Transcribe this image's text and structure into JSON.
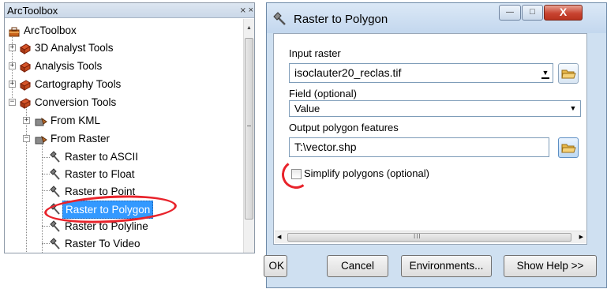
{
  "toolbox": {
    "title": "ArcToolbox",
    "pin_glyph": "⨯",
    "close_glyph": "×",
    "root": "ArcToolbox",
    "items": [
      {
        "label": "3D Analyst Tools",
        "expander": "+",
        "icon": "toolbox-icon"
      },
      {
        "label": "Analysis Tools",
        "expander": "+",
        "icon": "toolbox-icon"
      },
      {
        "label": "Cartography Tools",
        "expander": "+",
        "icon": "toolbox-icon"
      },
      {
        "label": "Conversion Tools",
        "expander": "−",
        "icon": "toolbox-icon"
      }
    ],
    "toolsets": [
      {
        "label": "From KML",
        "expander": "+",
        "icon": "toolset-icon"
      },
      {
        "label": "From Raster",
        "expander": "−",
        "icon": "toolset-icon"
      }
    ],
    "tools": [
      {
        "label": "Raster to ASCII",
        "icon": "hammer-icon"
      },
      {
        "label": "Raster to Float",
        "icon": "hammer-icon"
      },
      {
        "label": "Raster to Point",
        "icon": "hammer-icon"
      },
      {
        "label": "Raster to Polygon",
        "icon": "hammer-icon",
        "selected": true
      },
      {
        "label": "Raster to Polyline",
        "icon": "hammer-icon"
      },
      {
        "label": "Raster To Video",
        "icon": "hammer-icon"
      }
    ]
  },
  "dialog": {
    "title": "Raster to Polygon",
    "minimize_glyph": "—",
    "maximize_glyph": "□",
    "close_glyph": "X",
    "input_raster_label": "Input raster",
    "input_raster_value": "isoclauter20_reclas.tif",
    "field_label": "Field (optional)",
    "field_value": "Value",
    "output_label": "Output polygon features",
    "output_value": "T:\\vector.shp",
    "simplify_label": "Simplify polygons (optional)",
    "simplify_checked": false,
    "scroll_grip": "III",
    "buttons": {
      "ok": "OK",
      "cancel": "Cancel",
      "environments": "Environments...",
      "show_help": "Show Help >>"
    }
  },
  "colors": {
    "highlight": "#e8232b",
    "selection": "#3399ff",
    "dialog_frame": "#cfe0f1"
  }
}
